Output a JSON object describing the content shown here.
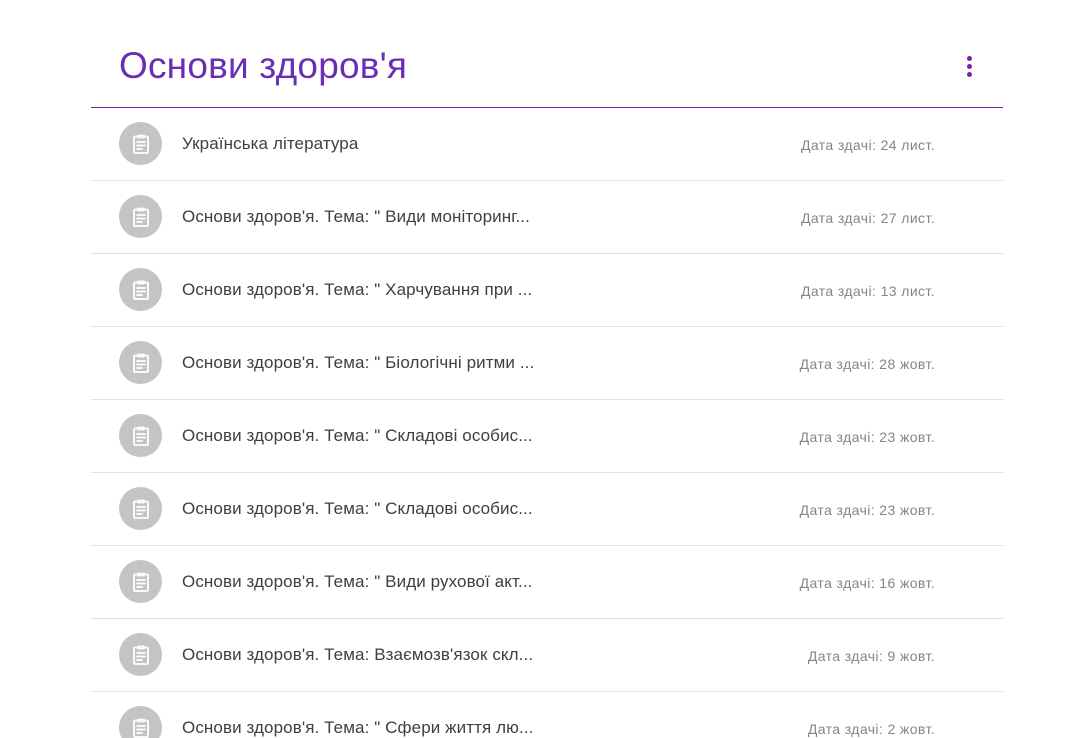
{
  "colors": {
    "accent": "#7b1fa2",
    "title": "#6a2db5",
    "icon_bg": "#c4c4c4",
    "icon_fg": "#ffffff"
  },
  "header": {
    "title": "Основи здоров'я",
    "menu_icon": "more-vert-icon"
  },
  "assignments": [
    {
      "title": "Українська література",
      "due": "Дата здачі: 24 лист.",
      "icon": "assignment-icon"
    },
    {
      "title": "Основи здоров'я. Тема: \" Види моніторинг...",
      "due": "Дата здачі: 27 лист.",
      "icon": "assignment-icon"
    },
    {
      "title": "Основи здоров'я. Тема: \" Харчування при ...",
      "due": "Дата здачі: 13 лист.",
      "icon": "assignment-icon"
    },
    {
      "title": "Основи здоров'я. Тема: \" Біологічні ритми ...",
      "due": "Дата здачі: 28 жовт.",
      "icon": "assignment-icon"
    },
    {
      "title": "Основи здоров'я. Тема: \" Складові особис...",
      "due": "Дата здачі: 23 жовт.",
      "icon": "assignment-icon"
    },
    {
      "title": "Основи здоров'я. Тема: \" Складові особис...",
      "due": "Дата здачі: 23 жовт.",
      "icon": "assignment-icon"
    },
    {
      "title": "Основи здоров'я. Тема: \" Види рухової акт...",
      "due": "Дата здачі: 16 жовт.",
      "icon": "assignment-icon"
    },
    {
      "title": "Основи здоров'я. Тема: Взаємозв'язок скл...",
      "due": "Дата здачі: 9 жовт.",
      "icon": "assignment-icon"
    },
    {
      "title": "Основи здоров'я. Тема: \" Сфери життя лю...",
      "due": "Дата здачі: 2 жовт.",
      "icon": "assignment-icon"
    }
  ]
}
